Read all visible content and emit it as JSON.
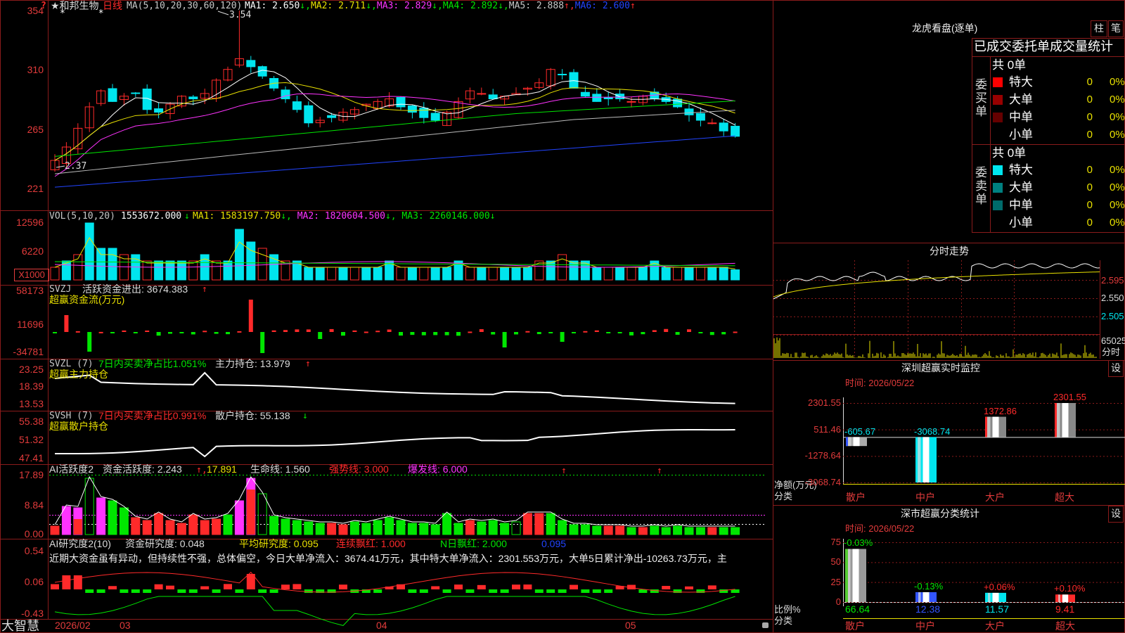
{
  "colors": {
    "up": "#ff2a2a",
    "down": "#00e5ee",
    "border": "#8a1b1b",
    "axis_text": "#e23b3b",
    "green": "#00e600",
    "magenta": "#ff33ff",
    "yellow": "#e8e000",
    "white": "#ffffff"
  },
  "stock": {
    "title": "★和邦生物",
    "period": "日线",
    "ma_header": "MA(5,10,20,30,60,120)",
    "top_marker": "?",
    "ma": [
      {
        "label": "MA1: 2.650",
        "arrow": "↓",
        "color": "#ffffff"
      },
      {
        "label": "MA2: 2.711",
        "arrow": "↓",
        "color": "#e8e000"
      },
      {
        "label": "MA3: 2.829",
        "arrow": "↓",
        "color": "#ff33ff"
      },
      {
        "label": "MA4: 2.892",
        "arrow": "↓",
        "color": "#00e600"
      },
      {
        "label": "MA5: 2.888",
        "arrow": "↑",
        "color": "#c8c8c8"
      },
      {
        "label": "MA6: 2.600",
        "arrow": "↑",
        "color": "#2244ff"
      }
    ],
    "y_ticks": [
      "354",
      "310",
      "265",
      "221"
    ],
    "high_mark": "3.54",
    "low_mark": "2.37"
  },
  "volume": {
    "header": "VOL(5,10,20)",
    "value": "1553672.000",
    "v_arrow": "↓",
    "ma": [
      {
        "label": "MA1: 1583197.750",
        "arrow": "↓",
        "color": "#e8e000"
      },
      {
        "label": "MA2: 1820604.500",
        "arrow": "↓",
        "color": "#ff33ff"
      },
      {
        "label": "MA3: 2260146.000",
        "arrow": "↓",
        "color": "#00e600"
      }
    ],
    "y_ticks": [
      "12596",
      "6220"
    ],
    "unit": "X1000"
  },
  "svzj": {
    "header": "SVZJ",
    "label": "活跃资金进出: 3674.383",
    "arrow": "↑",
    "sub": "超赢资金流(万元)",
    "y_ticks": [
      "58173",
      "11696",
      "-34781"
    ]
  },
  "svzl": {
    "header": "SVZL (7)",
    "label1": "7日内买卖净占比1.051%",
    "label2": "主力持仓: 13.979",
    "arrow": "↑",
    "sub": "超赢主力持仓",
    "y_ticks": [
      "23.25",
      "18.39",
      "13.53"
    ]
  },
  "svsh": {
    "header": "SVSH (7)",
    "label1": "7日内买卖净占比0.991%",
    "label2": "散户持仓: 55.138",
    "arrow": "↓",
    "sub": "超赢散户持仓",
    "y_ticks": [
      "55.38",
      "51.32",
      "47.41"
    ]
  },
  "ai_active": {
    "header": "AI活跃度2",
    "l1": "资金活跃度: 2.243",
    "l2": "17.891",
    "l3": "生命线: 1.560",
    "l4": "强势线: 3.000",
    "l5": "爆发线: 6.000",
    "y_ticks": [
      "17.89",
      "8.84",
      "0.00"
    ]
  },
  "ai_research": {
    "header": "AI研究度2(10)",
    "l1": "资金研究度: 0.048",
    "l2": "平均研究度: 0.095",
    "l3": "连续飘红: 1.000",
    "l4": "N日飘红: 2.000",
    "l5": "0.095",
    "comment": "近期大资金虽有异动，但持续性不强，总体偏空，今日大单净流入：3674.41万元，其中特大单净流入：2301.553万元，大单5日累计净出-10263.73万元，主",
    "y_ticks": [
      "0.54",
      "0.06",
      "-0.43"
    ]
  },
  "date_axis": {
    "year_month": "2026/02",
    "labels": [
      "03",
      "04",
      "05"
    ]
  },
  "brand": "大智慧",
  "dragon": {
    "title": "龙虎看盘(逐单)",
    "btn1": "柱",
    "btn2": "笔",
    "subtitle": "已成交委托单成交量统计",
    "buy_side": "委买单",
    "sell_side": "委卖单",
    "buy_total": "共 0单",
    "sell_total": "共 0单",
    "buy_rows": [
      {
        "name": "特大",
        "count": "0",
        "pct": "0%",
        "color": "#ff0000"
      },
      {
        "name": "大单",
        "count": "0",
        "pct": "0%",
        "color": "#990000"
      },
      {
        "name": "中单",
        "count": "0",
        "pct": "0%",
        "color": "#660000"
      },
      {
        "name": "小单",
        "count": "0",
        "pct": "0%",
        "color": ""
      }
    ],
    "sell_rows": [
      {
        "name": "特大",
        "count": "0",
        "pct": "0%",
        "color": "#00e5ee"
      },
      {
        "name": "大单",
        "count": "0",
        "pct": "0%",
        "color": "#008080"
      },
      {
        "name": "中单",
        "count": "0",
        "pct": "0%",
        "color": "#006b6b"
      },
      {
        "name": "小单",
        "count": "0",
        "pct": "0%",
        "color": ""
      }
    ]
  },
  "intraday": {
    "title": "分时走势",
    "y_ticks": [
      "2.595",
      "2.550",
      "2.505"
    ],
    "vol_tick": "65025",
    "time_label": "分时"
  },
  "monitor": {
    "title": "深圳超赢实时监控",
    "setting": "设",
    "time": "时间: 2026/05/22",
    "net_label": "净额(万元)",
    "cat_label": "分类",
    "y_ticks": [
      "2301.55",
      "511.46",
      "-1278.64",
      "-3068.74"
    ],
    "categories": [
      "散户",
      "中户",
      "大户",
      "超大"
    ],
    "values": [
      -605.67,
      -3068.74,
      1372.86,
      2301.55
    ],
    "value_labels": [
      "-605.67",
      "-3068.74",
      "1372.86",
      "2301.55"
    ]
  },
  "classify": {
    "title": "深市超赢分类统计",
    "setting": "设",
    "time": "时间: 2026/05/22",
    "ratio_label": "比例%",
    "cat_label": "分类",
    "y_ticks": [
      "75",
      "50",
      "25",
      "0"
    ],
    "categories": [
      "散户",
      "中户",
      "大户",
      "超大"
    ],
    "values": [
      66.64,
      12.38,
      11.57,
      9.41
    ],
    "value_labels": [
      "66.64",
      "12.38",
      "11.57",
      "9.41"
    ],
    "changes": [
      "-0.03%",
      "-0.13%",
      "+0.06%",
      "+0.10%"
    ]
  }
}
